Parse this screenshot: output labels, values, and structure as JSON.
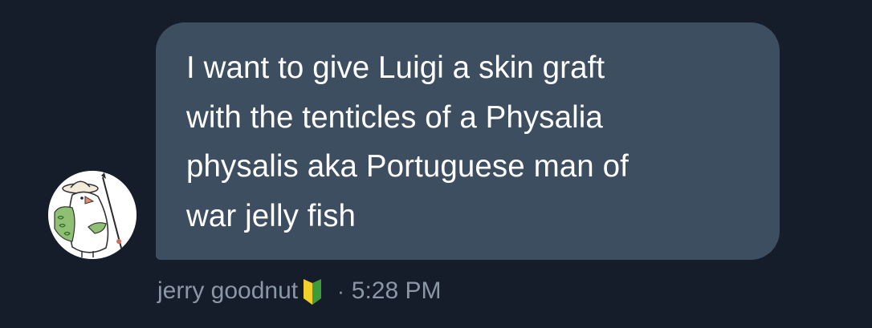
{
  "message": {
    "text": "I want to give Luigi a skin graft\nwith the tenticles of a Physalia\nphysalis aka Portuguese man of\nwar jelly fish",
    "sender": "jerry goodnut",
    "separator": "·",
    "timestamp": "5:28 PM"
  },
  "icons": {
    "avatar": "bird-with-staff-avatar",
    "badge": "beginner-leaf-icon"
  },
  "colors": {
    "background": "#151d2b",
    "bubble": "#3d4e61",
    "text": "#ffffff",
    "meta_text": "#8c97a6",
    "badge_green": "#3f9a3a",
    "badge_yellow": "#f2cf2b"
  }
}
